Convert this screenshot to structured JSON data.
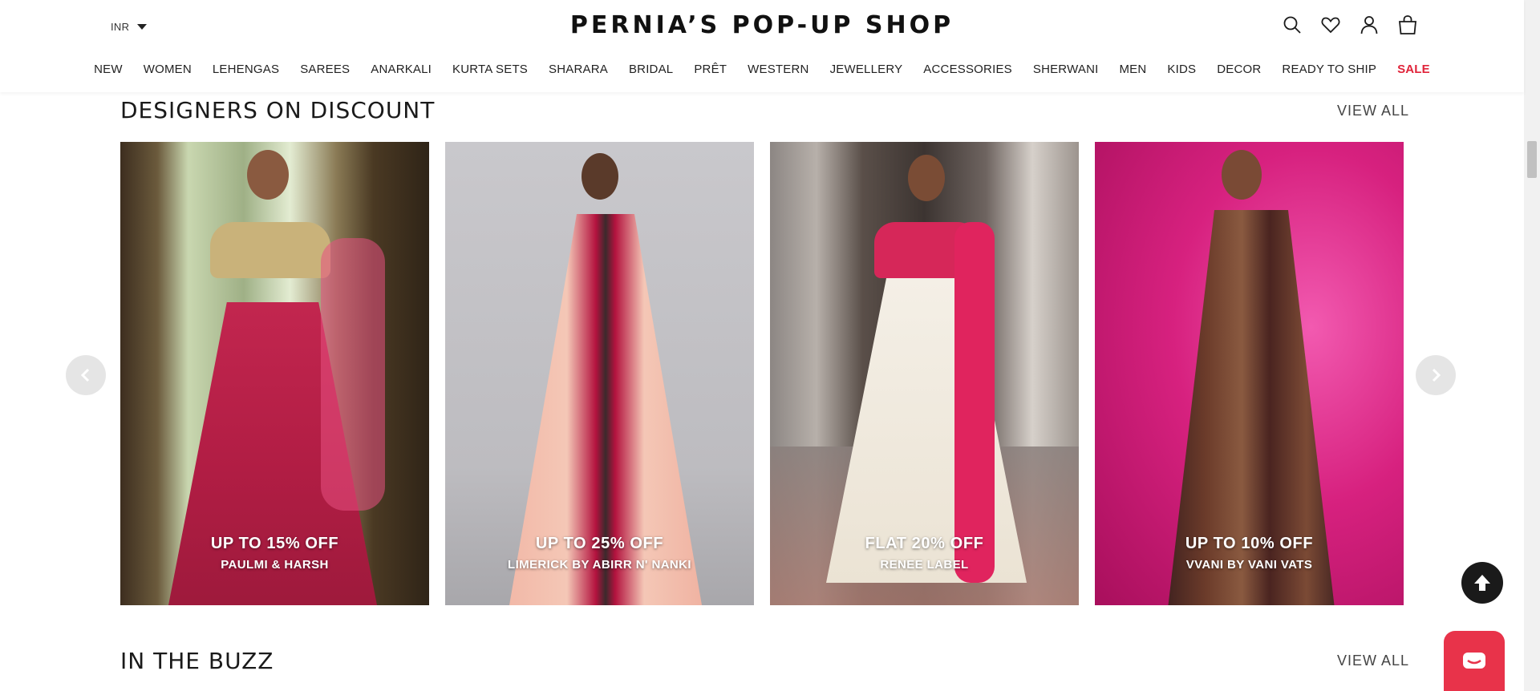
{
  "header": {
    "currency": "INR",
    "logo": "PERNIA’S POP-UP SHOP",
    "icons": [
      "search-icon",
      "heart-icon",
      "user-icon",
      "bag-icon"
    ]
  },
  "nav": {
    "items": [
      "NEW",
      "WOMEN",
      "LEHENGAS",
      "SAREES",
      "ANARKALI",
      "KURTA SETS",
      "SHARARA",
      "BRIDAL",
      "PRÊT",
      "WESTERN",
      "JEWELLERY",
      "ACCESSORIES",
      "SHERWANI",
      "MEN",
      "KIDS",
      "DECOR",
      "READY TO SHIP",
      "SALE"
    ],
    "sale_color": "#e0243a"
  },
  "discount": {
    "title": "DESIGNERS ON DISCOUNT",
    "view_all": "VIEW ALL",
    "cards": [
      {
        "offer": "UP TO 15% OFF",
        "designer": "PAULMI & HARSH"
      },
      {
        "offer": "UP TO 25% OFF",
        "designer": "LIMERICK BY ABIRR N' NANKI"
      },
      {
        "offer": "FLAT 20% OFF",
        "designer": "RENEE LABEL"
      },
      {
        "offer": "UP TO 10% OFF",
        "designer": "VVANI BY VANI VATS"
      }
    ]
  },
  "buzz": {
    "title": "IN THE BUZZ",
    "view_all": "VIEW ALL"
  },
  "colors": {
    "chat_button": "#e8334a",
    "back_to_top": "#1a1a1a"
  }
}
